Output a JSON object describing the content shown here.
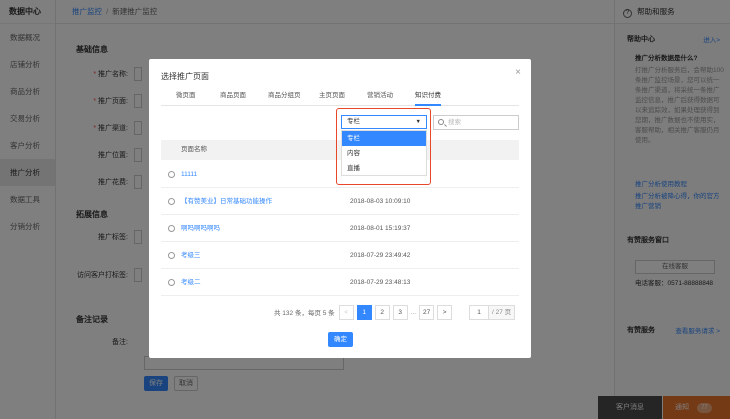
{
  "sidebar": {
    "brand": "数据中心",
    "items": [
      {
        "label": "数据概况"
      },
      {
        "label": "店铺分析"
      },
      {
        "label": "商品分析"
      },
      {
        "label": "交易分析"
      },
      {
        "label": "客户分析"
      },
      {
        "label": "推广分析"
      },
      {
        "label": "数据工具"
      },
      {
        "label": "分销分析"
      }
    ]
  },
  "breadcrumb": {
    "parent": "推广监控",
    "separator": "/",
    "current": "新建推广监控"
  },
  "form": {
    "basic_title": "基础信息",
    "fields": [
      {
        "label": "推广名称:",
        "required": true
      },
      {
        "label": "推广页面:",
        "required": true
      },
      {
        "label": "推广渠道:",
        "required": true
      },
      {
        "label": "推广位置:",
        "required": false
      },
      {
        "label": "推广花费:",
        "required": false
      }
    ],
    "ext_title": "拓展信息",
    "ext_fields": [
      {
        "label": "推广标签:"
      },
      {
        "label": "访问客户打标签:"
      }
    ],
    "remark_title": "备注记录",
    "remark_label": "备注:",
    "save_label": "保存",
    "cancel_label": "取消"
  },
  "help": {
    "header": "帮助和服务",
    "center_title": "帮助中心",
    "center_link": "进入>",
    "question": "推广分析数据是什么?",
    "answer": "打推广分析服务后，会帮助100条推广监控场景，您可以统一条推广渠道，将采统一条推广监控信息，推广后获得数据可以来追踪效，如果处理获得到您期，推广数据也不使用实，客服帮助，相关推广客服仍月使用。",
    "link1": "推广分析使用教程",
    "link2": "推广分析被降心得，你的官方推广营销",
    "service_title": "有赞服务窗口",
    "service_btn": "在线客服",
    "phone": "电话客服：0571-88888848",
    "bottom_title": "有赞服务",
    "bottom_link": "查看服务请求 >"
  },
  "bottom_bar": {
    "chat_label": "客户消息",
    "notice_label": "通知",
    "notice_count": "77"
  },
  "modal": {
    "title": "选择推广页面",
    "close": "×",
    "tabs": [
      {
        "label": "微页面",
        "active": false
      },
      {
        "label": "商品页面",
        "active": false
      },
      {
        "label": "商品分组页",
        "active": false
      },
      {
        "label": "主页页面",
        "active": false
      },
      {
        "label": "营销活动",
        "active": false
      },
      {
        "label": "知识付费",
        "active": true
      }
    ],
    "select": {
      "value": "专栏",
      "caret": "▼",
      "options": [
        "专栏",
        "内容",
        "直播"
      ],
      "selected_index": 0
    },
    "search_placeholder": "搜索",
    "table_header": "页面名称",
    "rows": [
      {
        "name": "11111",
        "time": ""
      },
      {
        "name": "【有赞美业】日常基础功能操作",
        "time": "2018-08-03 10:09:10"
      },
      {
        "name": "啊吗啊吗啊吗",
        "time": "2018-08-01 15:19:37"
      },
      {
        "name": "考级三",
        "time": "2018-07-29 23:49:42"
      },
      {
        "name": "考级二",
        "time": "2018-07-29 23:48:13"
      }
    ],
    "pager": {
      "info": "共 132 条，每页 5 条",
      "prev": "<",
      "pages": [
        "1",
        "2",
        "3"
      ],
      "dots": "...",
      "last": "27",
      "next": ">",
      "jump_value": "1",
      "total": "/ 27 页"
    },
    "confirm_label": "确定"
  }
}
